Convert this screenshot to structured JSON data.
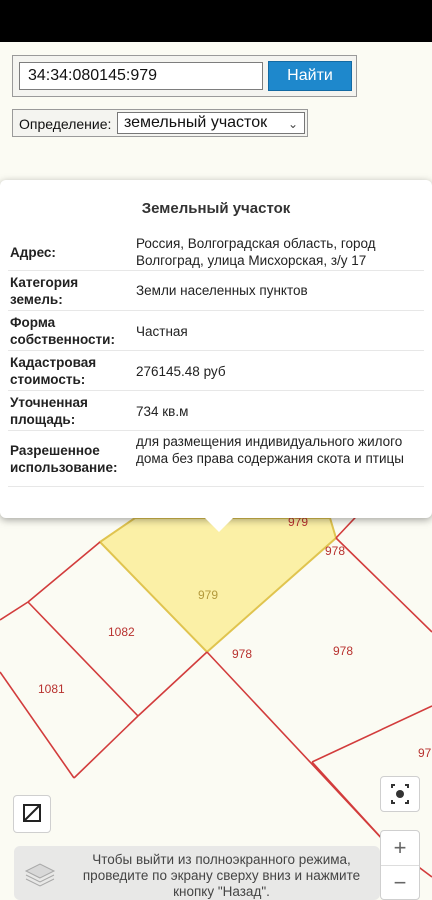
{
  "search": {
    "value": "34:34:080145:979",
    "button_label": "Найти"
  },
  "definition": {
    "label": "Определение:",
    "selected": "земельный участок"
  },
  "popup": {
    "title": "Земельный участок",
    "rows": [
      {
        "key": "Адрес:",
        "value": "Россия, Волгоградская область, город Волгоград, улица Мисхорская, з/у 17"
      },
      {
        "key": "Категория земель:",
        "value": "Земли населенных пунктов"
      },
      {
        "key": "Форма собственности:",
        "value": "Частная"
      },
      {
        "key": "Кадастровая стоимость:",
        "value": "276145.48 руб"
      },
      {
        "key": "Уточненная площадь:",
        "value": "734 кв.м"
      },
      {
        "key": "Разрешенное использование:",
        "value": "для размещения индивидуального жилого дома без права содержания скота и птицы"
      }
    ]
  },
  "map_labels": {
    "p979_top": "979",
    "p978_a": "978",
    "p979_main": "979",
    "p1082": "1082",
    "p978_b": "978",
    "p978_c": "978",
    "p1081": "1081",
    "p97_edge": "97"
  },
  "toast": {
    "text": "Чтобы выйти из полноэкранного режима, проведите по экрану сверху вниз и нажмите кнопку \"Назад\"."
  },
  "zoom": {
    "in": "+",
    "out": "−"
  },
  "colors": {
    "parcel_line": "#d23c3c",
    "selected_fill": "#fbf0a6",
    "selected_stroke": "#e0c44f",
    "button": "#1e88cc"
  }
}
